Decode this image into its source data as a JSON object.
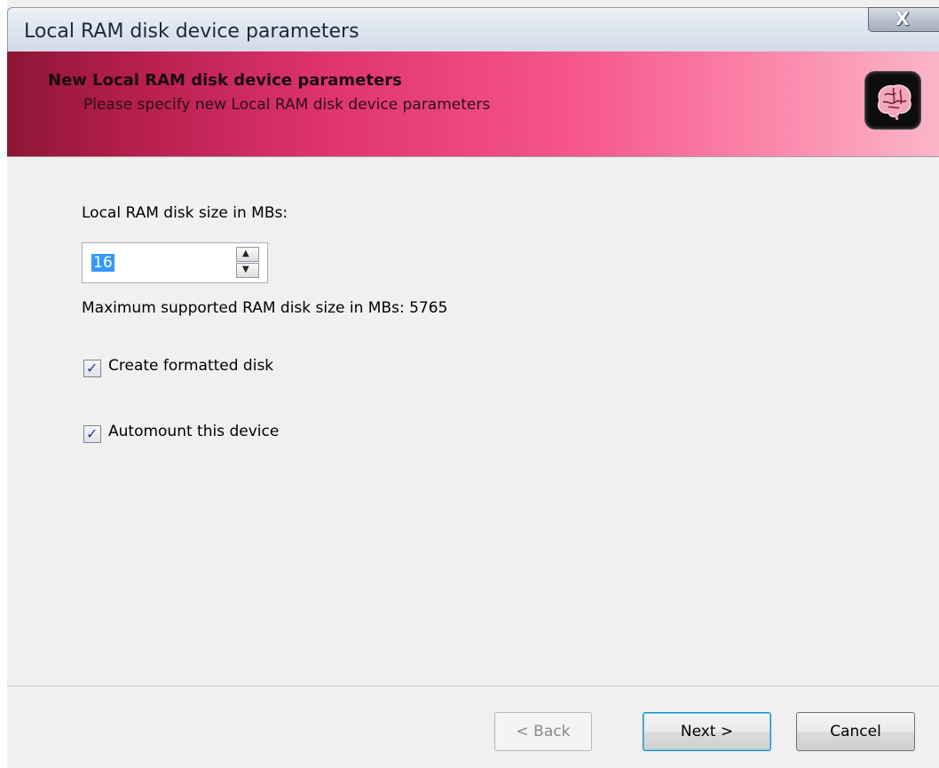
{
  "window": {
    "title": "Local RAM disk device parameters",
    "close_label": "X"
  },
  "header": {
    "title": "New Local RAM disk device parameters",
    "subtitle": "Please specify new Local RAM disk device parameters",
    "icon": "brain-icon"
  },
  "form": {
    "size_label": "Local RAM disk size in MBs:",
    "size_value": "16",
    "max_size_text": "Maximum supported RAM disk size in MBs: 5765",
    "create_formatted": {
      "label": "Create formatted disk",
      "checked": true
    },
    "automount": {
      "label": "Automount this device",
      "checked": true
    }
  },
  "buttons": {
    "back": "< Back",
    "next": "Next >",
    "cancel": "Cancel"
  },
  "colors": {
    "header_dark": "#8c1636",
    "header_mid": "#e0346f",
    "header_light": "#fbb5c9",
    "selection": "#3399ff",
    "dialog_bg": "#f0f0f0"
  }
}
